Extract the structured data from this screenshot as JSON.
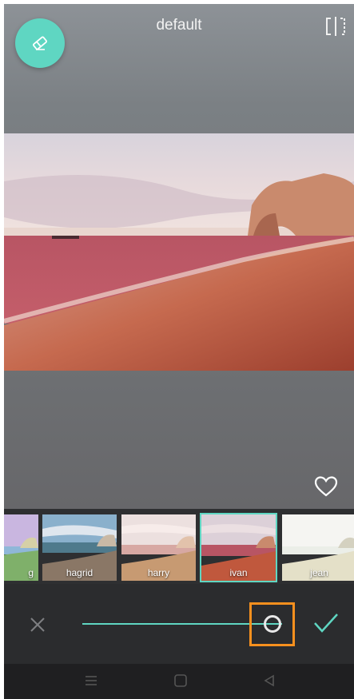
{
  "header": {
    "title": "default"
  },
  "filters": [
    {
      "label": "g"
    },
    {
      "label": "hagrid"
    },
    {
      "label": "harry"
    },
    {
      "label": "ivan"
    },
    {
      "label": "jean"
    }
  ],
  "selected_filter": "ivan",
  "slider": {
    "value": 0.95
  },
  "colors": {
    "accent": "#5fd6c2",
    "highlight": "#f7901e"
  },
  "icons": {
    "eraser": "eraser-icon",
    "compare": "compare-icon",
    "favorite": "heart-icon",
    "cancel": "close-icon",
    "confirm": "check-icon",
    "nav_menu": "menu-icon",
    "nav_home": "home-icon",
    "nav_back": "back-icon"
  }
}
